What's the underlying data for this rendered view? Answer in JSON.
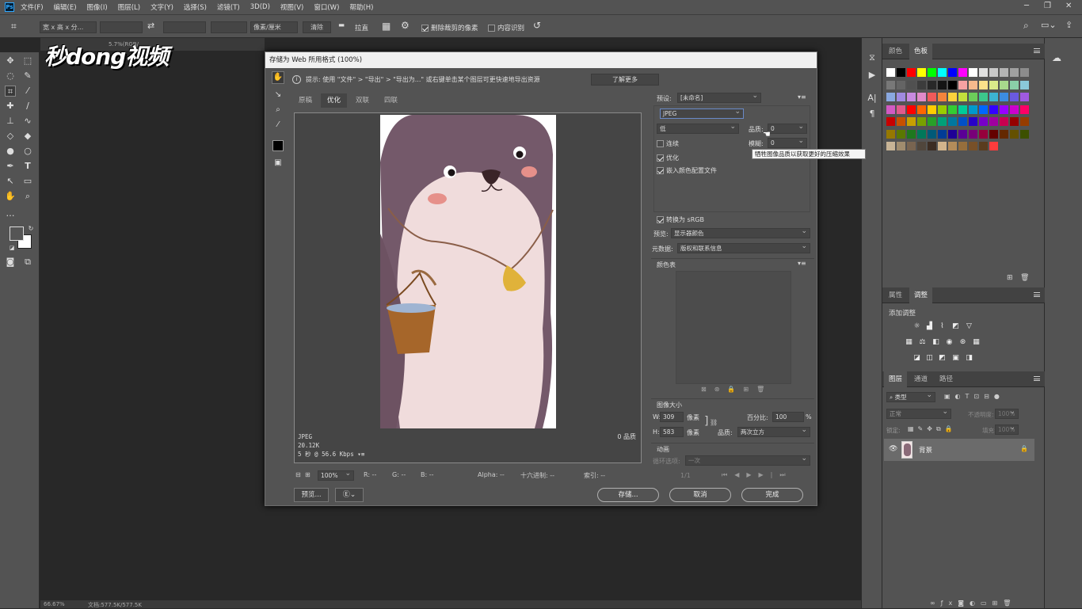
{
  "menu": {
    "items": [
      "文件(F)",
      "编辑(E)",
      "图像(I)",
      "图层(L)",
      "文字(Y)",
      "选择(S)",
      "滤镜(T)",
      "3D(D)",
      "视图(V)",
      "窗口(W)",
      "帮助(H)"
    ]
  },
  "options": {
    "ratio": "宽 x 高 x 分...",
    "units": "像素/厘米",
    "clear": "清除",
    "straighten": "拉直",
    "delete_cropped": "删除裁剪的像素",
    "content_aware": "内容识别"
  },
  "watermark": "秒dong视频",
  "doc_tab_fragment": "5.7%(RGB/",
  "status": {
    "zoom": "66.67%",
    "doc": "文档:577.5K/577.5K"
  },
  "dialog": {
    "title": "存储为 Web 所用格式 (100%)",
    "hint": "提示:  使用 \"文件\" > \"导出\" > \"导出为...\" 或右键单击某个图层可更快速地导出资源",
    "learn_more": "了解更多",
    "tabs": [
      "原稿",
      "优化",
      "双联",
      "四联"
    ],
    "preview_info": [
      "JPEG",
      "20.12K",
      "5 秒 @ 56.6 Kbps"
    ],
    "preview_quality": "0 品质",
    "zoom": "100%",
    "readout": {
      "r": "R: --",
      "g": "G: --",
      "b": "B: --",
      "alpha": "Alpha: --",
      "hex": "十六进制: --",
      "index": "索引: --"
    },
    "preview_btn": "预览...",
    "save_btn": "存储...",
    "cancel_btn": "取消",
    "done_btn": "完成",
    "settings": {
      "preset_label": "预设:",
      "preset_value": "[未命名]",
      "format": "JPEG",
      "quality_level": "低",
      "quality_label": "品质:",
      "quality_value": "0",
      "blur_label": "模糊:",
      "blur_value": "0",
      "progressive": "连续",
      "optimized": "优化",
      "embed_profile": "嵌入颜色配置文件",
      "tooltip": "牺牲图像品质以获取更好的压缩效果",
      "convert_srgb": "转换为 sRGB",
      "preview_label": "预览:",
      "preview_value": "显示器颜色",
      "metadata_label": "元数据:",
      "metadata_value": "版权和联系信息",
      "color_table": "颜色表",
      "image_size": "图像大小",
      "w_label": "W:",
      "w_value": "309",
      "h_label": "H:",
      "h_value": "583",
      "px": "像素",
      "percent_label": "百分比:",
      "percent_value": "100",
      "percent_unit": "%",
      "resample_label": "品质:",
      "resample_value": "两次立方",
      "animation": "动画",
      "loop_label": "循环选项:",
      "loop_value": "一次",
      "frame": "1/1"
    }
  },
  "panels": {
    "swatch_tabs": [
      "颜色",
      "色板"
    ],
    "adjust_tabs": [
      "属性",
      "调整"
    ],
    "add_adjustment": "添加调整",
    "layer_tabs": [
      "图层",
      "通道",
      "路径"
    ],
    "kind": "类型",
    "blend": "正常",
    "opacity_label": "不透明度:",
    "opacity_value": "100%",
    "lock_label": "锁定:",
    "fill_label": "填充:",
    "fill_value": "100%",
    "layer_name": "背景"
  },
  "swatches": [
    [
      "#ffffff",
      "#000000",
      "#ff0000",
      "#ffff00",
      "#00ff00",
      "#00ffff",
      "#0000ff",
      "#ff00ff",
      "#ffffff",
      "#e0e0e0",
      "#c8c8c8",
      "#b4b4b4",
      "#a0a0a0",
      "#8c8c8c"
    ],
    [
      "#787878",
      "#646464",
      "#505050",
      "#3c3c3c",
      "#282828",
      "#141414",
      "#000000",
      "#f5a2a2",
      "#f7b98c",
      "#fbe08a",
      "#d9ea8a",
      "#a8d98c",
      "#8ad0a8",
      "#8ac8d9"
    ],
    [
      "#8aa8e0",
      "#a08ae0",
      "#c88ae0",
      "#e08ac8",
      "#f05a5a",
      "#f5843c",
      "#fbd23c",
      "#c3e03c",
      "#6ccc5a",
      "#3cc88c",
      "#3cb4d2",
      "#3c8ce0",
      "#6a5ae0",
      "#a05ae0"
    ],
    [
      "#d25ac3",
      "#e05a8c",
      "#ff0000",
      "#ff6600",
      "#ffcc00",
      "#99cc00",
      "#33cc33",
      "#00cc99",
      "#0099cc",
      "#0066ff",
      "#3300ff",
      "#9900ff",
      "#cc00cc",
      "#ff0066"
    ],
    [
      "#c80000",
      "#c85000",
      "#c8a000",
      "#78a000",
      "#28a028",
      "#00a078",
      "#0078a0",
      "#0050c8",
      "#2800c8",
      "#7800c8",
      "#a000a0",
      "#c80050",
      "#960000",
      "#963c00"
    ],
    [
      "#967800",
      "#5a7800",
      "#1e781e",
      "#00785a",
      "#005a78",
      "#003c96",
      "#1e0096",
      "#5a0096",
      "#780078",
      "#96003c",
      "#640000",
      "#642800",
      "#645000",
      "#3c5000"
    ],
    [
      "#c8b496",
      "#a08c6e",
      "#786450",
      "#50463c",
      "#3c2d23",
      "#d2b48c",
      "#b48c5a",
      "#966e3c",
      "#785028",
      "#5a3c1e",
      "#ff3c3c"
    ]
  ]
}
